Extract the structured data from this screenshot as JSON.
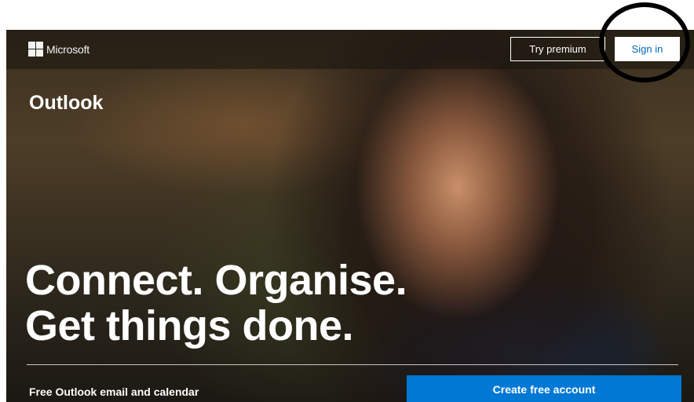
{
  "brand": {
    "logo_icon": "microsoft-logo-icon",
    "name": "Microsoft"
  },
  "header": {
    "try_premium_label": "Try premium",
    "sign_in_label": "Sign in"
  },
  "hero": {
    "product_name": "Outlook",
    "headline_line1": "Connect. Organise.",
    "headline_line2": "Get things done.",
    "tagline": "Free Outlook email and calendar",
    "create_account_label": "Create free account"
  },
  "colors": {
    "accent_blue": "#0078d4",
    "sign_in_text": "#0067b8",
    "annotation_circle": "#000000"
  }
}
